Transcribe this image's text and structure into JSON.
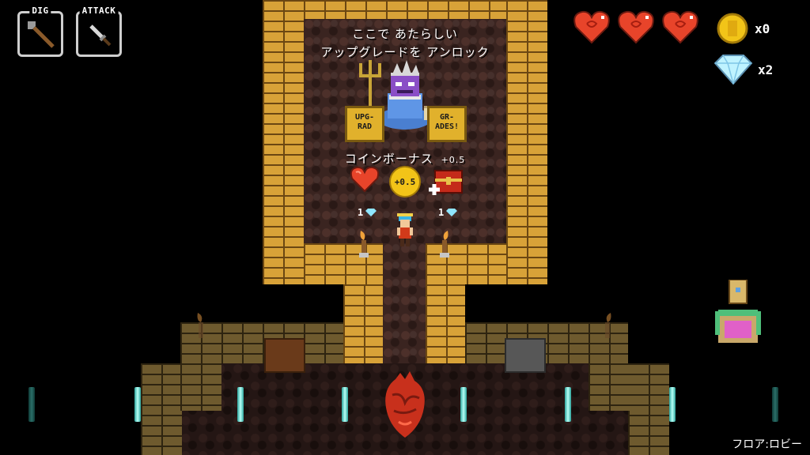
{
  "hud": {
    "dig_label": "DIG",
    "attack_label": "ATTACK",
    "coin_count": "x0",
    "diamond_count": "x2",
    "hearts": 3
  },
  "shrine": {
    "message_line1": "ここで あたらしい",
    "message_line2": "アップグレードを アンロック",
    "sign_left": "UPG-\nRAD",
    "sign_right": "GR-\nADES!",
    "bonus_label": "コインボーナス",
    "bonus_value": "+0.5",
    "coin_badge": "+0.5",
    "price_left": "1",
    "price_right": "1"
  },
  "footer": {
    "floor_label": "フロア:ロビー"
  },
  "colors": {
    "brick": "#d8a238",
    "floor": "#3a2420",
    "heart": "#e8442a",
    "crystal": "#7fe9dc",
    "coin": "#f2c418"
  }
}
